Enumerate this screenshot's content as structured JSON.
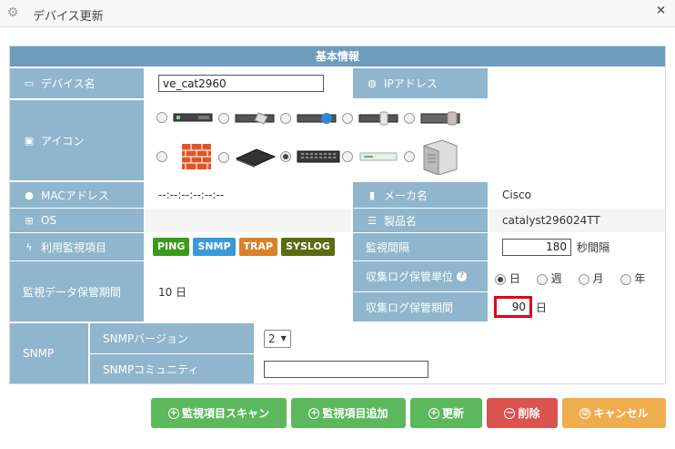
{
  "window": {
    "title": "デバイス更新",
    "close_glyph": "×"
  },
  "section_title": "基本情報",
  "device_name": {
    "label": "デバイス名",
    "value": "ve_cat2960"
  },
  "ip_address": {
    "label": "IPアドレス",
    "value": ""
  },
  "icon": {
    "label": "アイコン",
    "options": [
      {
        "name": "device-rack-server-1-icon",
        "selected": false
      },
      {
        "name": "device-rack-server-2-icon",
        "selected": false
      },
      {
        "name": "device-router-blue-icon",
        "selected": false
      },
      {
        "name": "device-rack-server-3-icon",
        "selected": false
      },
      {
        "name": "device-storage-icon",
        "selected": false
      },
      {
        "name": "device-firewall-icon",
        "selected": false
      },
      {
        "name": "device-switch-dark-icon",
        "selected": false
      },
      {
        "name": "device-switch-ports-icon",
        "selected": true
      },
      {
        "name": "device-small-router-icon",
        "selected": false
      },
      {
        "name": "device-server-chassis-icon",
        "selected": false
      }
    ]
  },
  "mac": {
    "label": "MACアドレス",
    "value": "--:--:--:--:--:--"
  },
  "maker": {
    "label": "メーカ名",
    "value": "Cisco"
  },
  "os": {
    "label": "OS",
    "value": ""
  },
  "product": {
    "label": "製品名",
    "value": "catalyst296024TT"
  },
  "monitor_items": {
    "label": "利用監視項目",
    "badges": [
      {
        "text": "PING",
        "color": "#3a9a1a"
      },
      {
        "text": "SNMP",
        "color": "#3a9ad5"
      },
      {
        "text": "TRAP",
        "color": "#d9822b"
      },
      {
        "text": "SYSLOG",
        "color": "#5b6b12"
      }
    ]
  },
  "interval": {
    "label": "監視間隔",
    "value": "180",
    "unit": "秒間隔"
  },
  "retention": {
    "label": "監視データ保管期間",
    "value": "10 日"
  },
  "log_unit": {
    "label": "収集ログ保管単位",
    "help_glyph": "?",
    "options": [
      {
        "text": "日",
        "selected": true
      },
      {
        "text": "週",
        "selected": false
      },
      {
        "text": "月",
        "selected": false
      },
      {
        "text": "年",
        "selected": false
      }
    ]
  },
  "log_period": {
    "label": "収集ログ保管期間",
    "value": "90",
    "unit": "日"
  },
  "snmp": {
    "label": "SNMP",
    "version_label": "SNMPバージョン",
    "version_value": "2",
    "community_label": "SNMPコミュニティ",
    "community_value": ""
  },
  "buttons": {
    "scan": "監視項目スキャン",
    "add": "監視項目追加",
    "update": "更新",
    "delete": "削除",
    "cancel": "キャンセル"
  },
  "colors": {
    "header": "#6d9cbc",
    "label": "#8fb6cd",
    "green": "#5cb85c",
    "red": "#d9534f",
    "orange": "#f0ad4e",
    "highlight": "#e0001b"
  }
}
